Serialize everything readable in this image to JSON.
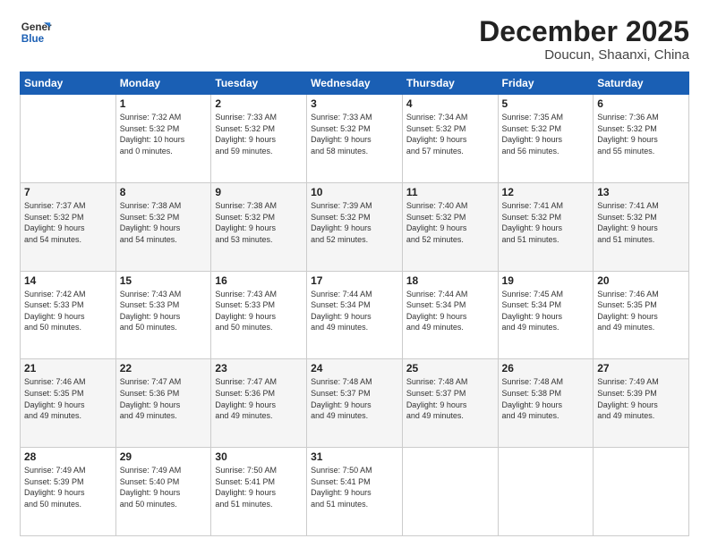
{
  "logo": {
    "line1": "General",
    "line2": "Blue"
  },
  "title": "December 2025",
  "subtitle": "Doucun, Shaanxi, China",
  "days_header": [
    "Sunday",
    "Monday",
    "Tuesday",
    "Wednesday",
    "Thursday",
    "Friday",
    "Saturday"
  ],
  "weeks": [
    [
      {
        "day": "",
        "info": ""
      },
      {
        "day": "1",
        "info": "Sunrise: 7:32 AM\nSunset: 5:32 PM\nDaylight: 10 hours\nand 0 minutes."
      },
      {
        "day": "2",
        "info": "Sunrise: 7:33 AM\nSunset: 5:32 PM\nDaylight: 9 hours\nand 59 minutes."
      },
      {
        "day": "3",
        "info": "Sunrise: 7:33 AM\nSunset: 5:32 PM\nDaylight: 9 hours\nand 58 minutes."
      },
      {
        "day": "4",
        "info": "Sunrise: 7:34 AM\nSunset: 5:32 PM\nDaylight: 9 hours\nand 57 minutes."
      },
      {
        "day": "5",
        "info": "Sunrise: 7:35 AM\nSunset: 5:32 PM\nDaylight: 9 hours\nand 56 minutes."
      },
      {
        "day": "6",
        "info": "Sunrise: 7:36 AM\nSunset: 5:32 PM\nDaylight: 9 hours\nand 55 minutes."
      }
    ],
    [
      {
        "day": "7",
        "info": "Sunrise: 7:37 AM\nSunset: 5:32 PM\nDaylight: 9 hours\nand 54 minutes."
      },
      {
        "day": "8",
        "info": "Sunrise: 7:38 AM\nSunset: 5:32 PM\nDaylight: 9 hours\nand 54 minutes."
      },
      {
        "day": "9",
        "info": "Sunrise: 7:38 AM\nSunset: 5:32 PM\nDaylight: 9 hours\nand 53 minutes."
      },
      {
        "day": "10",
        "info": "Sunrise: 7:39 AM\nSunset: 5:32 PM\nDaylight: 9 hours\nand 52 minutes."
      },
      {
        "day": "11",
        "info": "Sunrise: 7:40 AM\nSunset: 5:32 PM\nDaylight: 9 hours\nand 52 minutes."
      },
      {
        "day": "12",
        "info": "Sunrise: 7:41 AM\nSunset: 5:32 PM\nDaylight: 9 hours\nand 51 minutes."
      },
      {
        "day": "13",
        "info": "Sunrise: 7:41 AM\nSunset: 5:32 PM\nDaylight: 9 hours\nand 51 minutes."
      }
    ],
    [
      {
        "day": "14",
        "info": "Sunrise: 7:42 AM\nSunset: 5:33 PM\nDaylight: 9 hours\nand 50 minutes."
      },
      {
        "day": "15",
        "info": "Sunrise: 7:43 AM\nSunset: 5:33 PM\nDaylight: 9 hours\nand 50 minutes."
      },
      {
        "day": "16",
        "info": "Sunrise: 7:43 AM\nSunset: 5:33 PM\nDaylight: 9 hours\nand 50 minutes."
      },
      {
        "day": "17",
        "info": "Sunrise: 7:44 AM\nSunset: 5:34 PM\nDaylight: 9 hours\nand 49 minutes."
      },
      {
        "day": "18",
        "info": "Sunrise: 7:44 AM\nSunset: 5:34 PM\nDaylight: 9 hours\nand 49 minutes."
      },
      {
        "day": "19",
        "info": "Sunrise: 7:45 AM\nSunset: 5:34 PM\nDaylight: 9 hours\nand 49 minutes."
      },
      {
        "day": "20",
        "info": "Sunrise: 7:46 AM\nSunset: 5:35 PM\nDaylight: 9 hours\nand 49 minutes."
      }
    ],
    [
      {
        "day": "21",
        "info": "Sunrise: 7:46 AM\nSunset: 5:35 PM\nDaylight: 9 hours\nand 49 minutes."
      },
      {
        "day": "22",
        "info": "Sunrise: 7:47 AM\nSunset: 5:36 PM\nDaylight: 9 hours\nand 49 minutes."
      },
      {
        "day": "23",
        "info": "Sunrise: 7:47 AM\nSunset: 5:36 PM\nDaylight: 9 hours\nand 49 minutes."
      },
      {
        "day": "24",
        "info": "Sunrise: 7:48 AM\nSunset: 5:37 PM\nDaylight: 9 hours\nand 49 minutes."
      },
      {
        "day": "25",
        "info": "Sunrise: 7:48 AM\nSunset: 5:37 PM\nDaylight: 9 hours\nand 49 minutes."
      },
      {
        "day": "26",
        "info": "Sunrise: 7:48 AM\nSunset: 5:38 PM\nDaylight: 9 hours\nand 49 minutes."
      },
      {
        "day": "27",
        "info": "Sunrise: 7:49 AM\nSunset: 5:39 PM\nDaylight: 9 hours\nand 49 minutes."
      }
    ],
    [
      {
        "day": "28",
        "info": "Sunrise: 7:49 AM\nSunset: 5:39 PM\nDaylight: 9 hours\nand 50 minutes."
      },
      {
        "day": "29",
        "info": "Sunrise: 7:49 AM\nSunset: 5:40 PM\nDaylight: 9 hours\nand 50 minutes."
      },
      {
        "day": "30",
        "info": "Sunrise: 7:50 AM\nSunset: 5:41 PM\nDaylight: 9 hours\nand 51 minutes."
      },
      {
        "day": "31",
        "info": "Sunrise: 7:50 AM\nSunset: 5:41 PM\nDaylight: 9 hours\nand 51 minutes."
      },
      {
        "day": "",
        "info": ""
      },
      {
        "day": "",
        "info": ""
      },
      {
        "day": "",
        "info": ""
      }
    ]
  ]
}
